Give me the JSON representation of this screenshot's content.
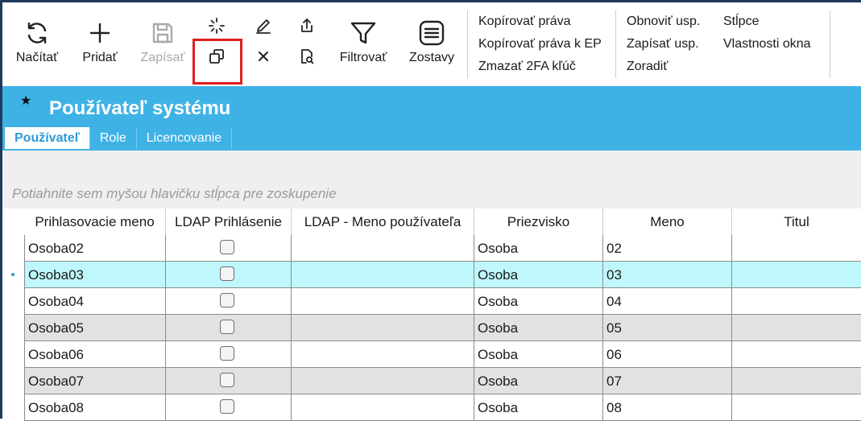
{
  "toolbar": {
    "reload_label": "Načítať",
    "add_label": "Pridať",
    "save_label": "Zapísať",
    "filter_label": "Filtrovať",
    "reports_label": "Zostavy",
    "menu_col1": [
      "Kopírovať práva",
      "Kopírovať práva k EP",
      "Zmazať 2FA kľúč"
    ],
    "menu_col2": [
      "Obnoviť usp.",
      "Zapísať usp.",
      "Zoradiť"
    ],
    "menu_col3": [
      "Stĺpce",
      "Vlastnosti okna"
    ]
  },
  "header": {
    "title": "Používateľ systému",
    "tabs": [
      "Používateľ",
      "Role",
      "Licencovanie"
    ]
  },
  "group_hint": "Potiahnite sem myšou hlavičku stĺpca pre zoskupenie",
  "grid": {
    "columns": [
      "Prihlasovacie meno",
      "LDAP Prihlásenie",
      "LDAP - Meno používateľa",
      "Priezvisko",
      "Meno",
      "Titul"
    ],
    "rows": [
      {
        "login": "Osoba02",
        "ldap": false,
        "ldap_name": "",
        "surname": "Osoba",
        "name": "02",
        "title": ""
      },
      {
        "login": "Osoba03",
        "ldap": false,
        "ldap_name": "",
        "surname": "Osoba",
        "name": "03",
        "title": ""
      },
      {
        "login": "Osoba04",
        "ldap": false,
        "ldap_name": "",
        "surname": "Osoba",
        "name": "04",
        "title": ""
      },
      {
        "login": "Osoba05",
        "ldap": false,
        "ldap_name": "",
        "surname": "Osoba",
        "name": "05",
        "title": ""
      },
      {
        "login": "Osoba06",
        "ldap": false,
        "ldap_name": "",
        "surname": "Osoba",
        "name": "06",
        "title": ""
      },
      {
        "login": "Osoba07",
        "ldap": false,
        "ldap_name": "",
        "surname": "Osoba",
        "name": "07",
        "title": ""
      },
      {
        "login": "Osoba08",
        "ldap": false,
        "ldap_name": "",
        "surname": "Osoba",
        "name": "08",
        "title": ""
      }
    ],
    "selected_row": 1
  },
  "colors": {
    "header_bg": "#3fb2e5",
    "selected_row_bg": "#bff8fc",
    "alt_row_bg": "#e2e2e2",
    "highlight_border": "#e01e1e"
  },
  "icons": [
    "refresh-icon",
    "plus-icon",
    "save-icon",
    "loading-spinner-icon",
    "copy-icon",
    "pencil-icon",
    "close-icon",
    "export-icon",
    "document-search-icon",
    "filter-icon",
    "reports-icon",
    "star-icon"
  ]
}
